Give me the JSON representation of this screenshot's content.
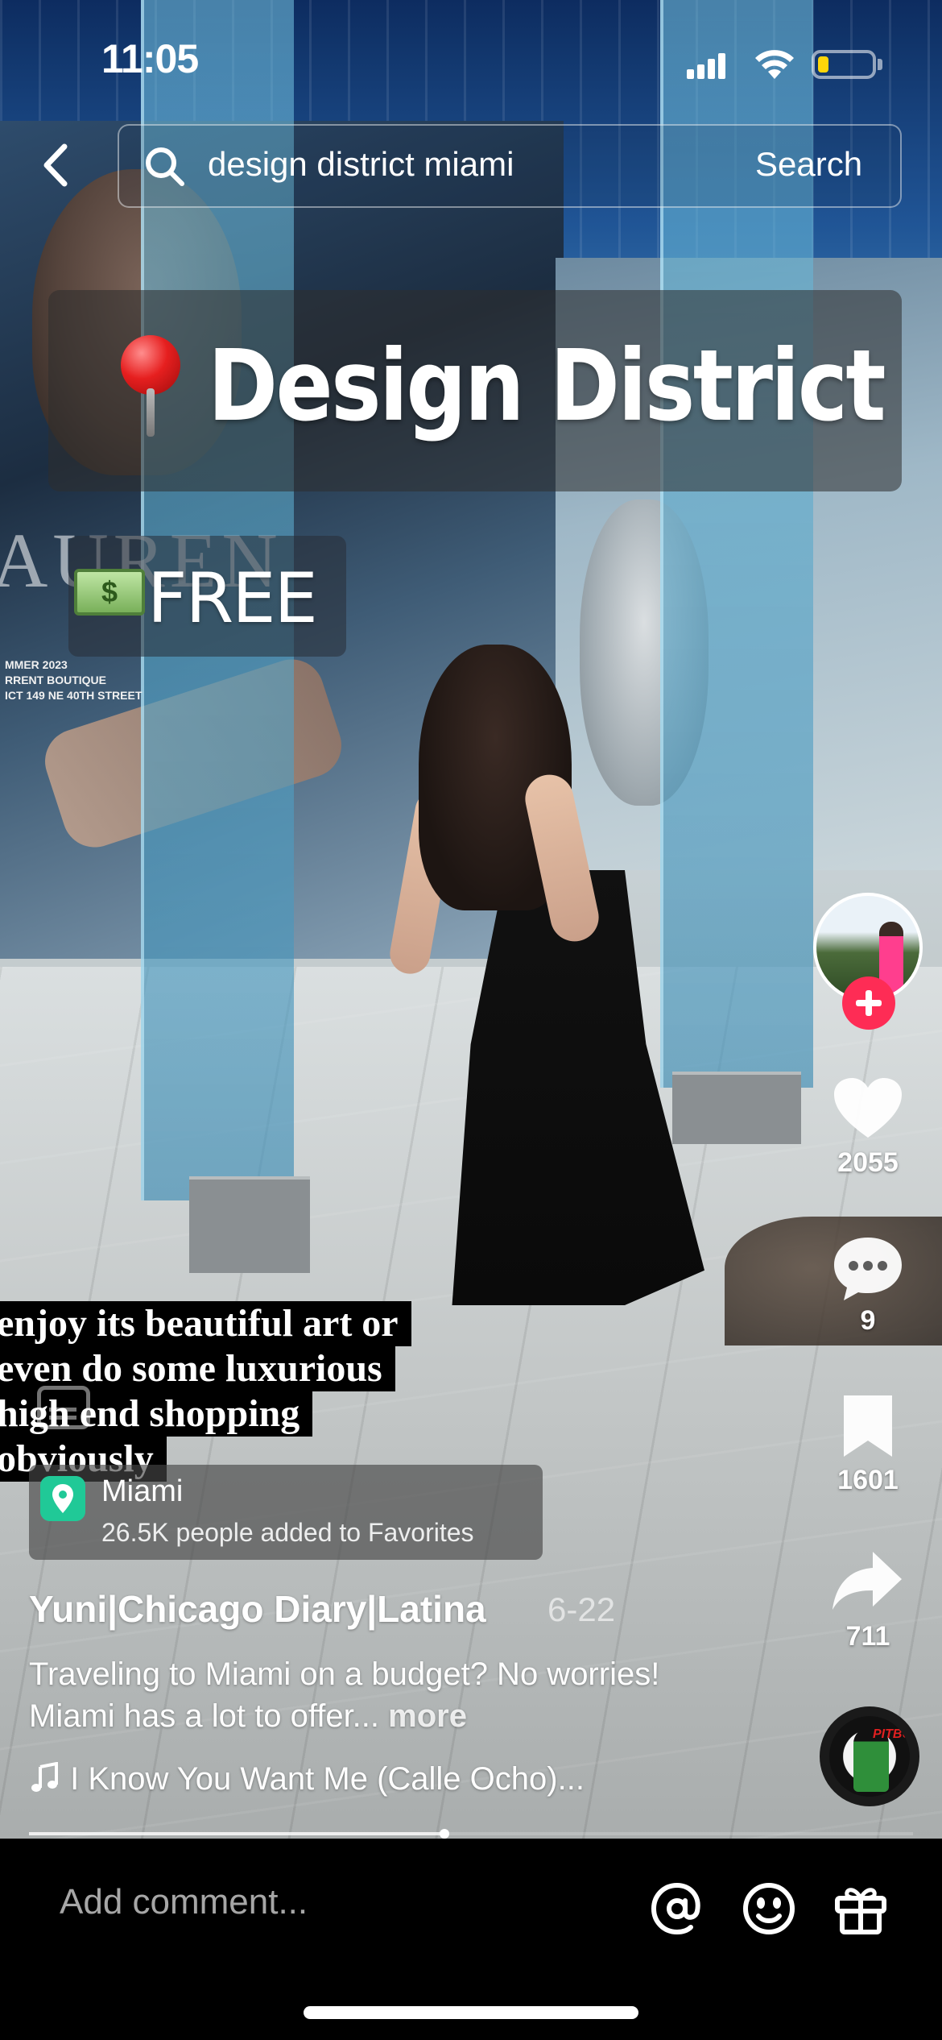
{
  "status_bar": {
    "time": "11:05",
    "battery_level": 0.2
  },
  "search": {
    "query": "design district miami",
    "button_label": "Search"
  },
  "overlay": {
    "title": "Design District",
    "free_label": "FREE",
    "billboard_word": "AUREN",
    "billboard_small": [
      "MMER 2023",
      "RRENT BOUTIQUE",
      "ICT 149 NE 40TH STREET"
    ],
    "caption_lines": [
      "enjoy its beautiful art or",
      "even do some luxurious",
      "high end shopping",
      "obviously"
    ]
  },
  "sidebar": {
    "likes": "2055",
    "comments": "9",
    "saves": "1601",
    "shares": "711",
    "disc_label": "PITBU"
  },
  "place": {
    "name": "Miami",
    "subtitle": "26.5K people added to Favorites"
  },
  "post": {
    "author": "Yuni|Chicago Diary|Latina",
    "date": "6-22",
    "description": "Traveling to Miami on a budget? No worries! Miami has a lot to offer...",
    "more_label": "more",
    "music": "I Know You Want Me (Calle Ocho)..."
  },
  "playback": {
    "progress": 0.47
  },
  "comment_bar": {
    "placeholder": "Add comment..."
  }
}
